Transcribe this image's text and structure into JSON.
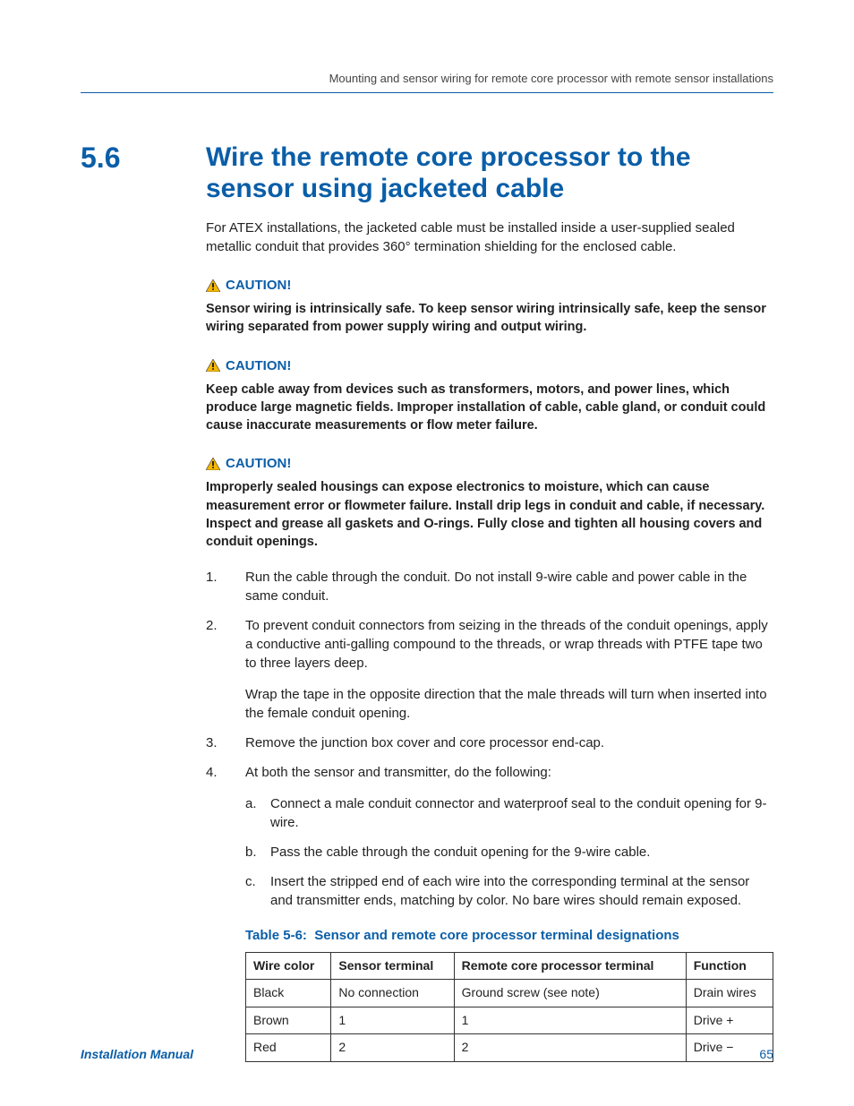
{
  "header": {
    "running_head": "Mounting and sensor wiring for remote core processor with remote sensor installations"
  },
  "section": {
    "number": "5.6",
    "title": "Wire the remote core processor to the sensor using jacketed cable",
    "intro": "For ATEX installations, the jacketed cable must be installed inside a user-supplied sealed metallic conduit that provides 360° termination shielding for the enclosed cable."
  },
  "cautions": [
    {
      "label": "CAUTION!",
      "text": "Sensor wiring is intrinsically safe. To keep sensor wiring intrinsically safe, keep the sensor wiring separated from power supply wiring and output wiring."
    },
    {
      "label": "CAUTION!",
      "text": "Keep cable away from devices such as transformers, motors, and power lines, which produce large magnetic fields. Improper installation of cable, cable gland, or conduit could cause inaccurate measurements or flow meter failure."
    },
    {
      "label": "CAUTION!",
      "text": "Improperly sealed housings can expose electronics to moisture, which can cause measurement error or flowmeter failure. Install drip legs in conduit and cable, if necessary. Inspect and grease all gaskets and O-rings. Fully close and tighten all housing covers and conduit openings."
    }
  ],
  "steps": [
    {
      "num": "1.",
      "paras": [
        "Run the cable through the conduit. Do not install 9-wire cable and power cable in the same conduit."
      ]
    },
    {
      "num": "2.",
      "paras": [
        "To prevent conduit connectors from seizing in the threads of the conduit openings, apply a conductive anti-galling compound to the threads, or wrap threads with PTFE tape two to three layers deep.",
        "Wrap the tape in the opposite direction that the male threads will turn when inserted into the female conduit opening."
      ]
    },
    {
      "num": "3.",
      "paras": [
        "Remove the junction box cover and core processor end-cap."
      ]
    },
    {
      "num": "4.",
      "paras": [
        "At both the sensor and transmitter, do the following:"
      ],
      "substeps": [
        {
          "letter": "a.",
          "text": "Connect a male conduit connector and waterproof seal to the conduit opening for 9-wire."
        },
        {
          "letter": "b.",
          "text": "Pass the cable through the conduit opening for the 9-wire cable."
        },
        {
          "letter": "c.",
          "text": "Insert the stripped end of each wire into the corresponding terminal at the sensor and transmitter ends, matching by color. No bare wires should remain exposed."
        }
      ]
    }
  ],
  "table": {
    "caption_label": "Table 5-6:",
    "caption_text": "Sensor and remote core processor terminal designations",
    "headers": [
      "Wire color",
      "Sensor terminal",
      "Remote core processor terminal",
      "Function"
    ],
    "rows": [
      [
        "Black",
        "No connection",
        "Ground screw (see note)",
        "Drain wires"
      ],
      [
        "Brown",
        "1",
        "1",
        "Drive +"
      ],
      [
        "Red",
        "2",
        "2",
        "Drive −"
      ]
    ]
  },
  "footer": {
    "left": "Installation Manual",
    "right": "65"
  }
}
